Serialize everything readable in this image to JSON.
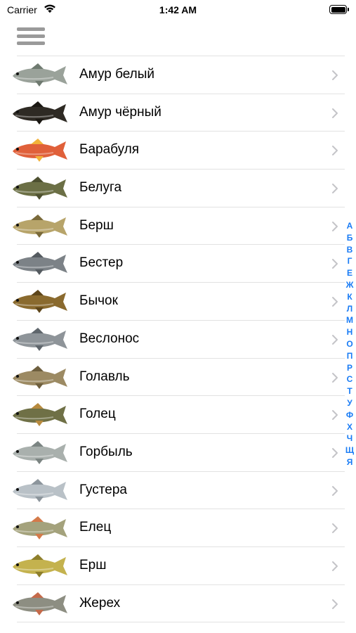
{
  "status_bar": {
    "carrier": "Carrier",
    "time": "1:42 AM",
    "icons": [
      "wifi-icon",
      "battery-icon"
    ]
  },
  "nav": {
    "menu_icon": "hamburger-menu-icon"
  },
  "colors": {
    "accent": "#1a7cf5",
    "separator": "#e2e2e2",
    "chevron": "#c4c4c8",
    "menu": "#9a9a9a"
  },
  "fish": [
    {
      "name": "Амур белый",
      "body": "#9aa29a",
      "fin": "#6f7a70"
    },
    {
      "name": "Амур чёрный",
      "body": "#2e2a24",
      "fin": "#1a1712"
    },
    {
      "name": "Барабуля",
      "body": "#e0603a",
      "fin": "#f2b23a"
    },
    {
      "name": "Белуга",
      "body": "#6b6f45",
      "fin": "#4d5030"
    },
    {
      "name": "Берш",
      "body": "#b7a46a",
      "fin": "#7a6a3a"
    },
    {
      "name": "Бестер",
      "body": "#7c8287",
      "fin": "#555b60"
    },
    {
      "name": "Бычок",
      "body": "#8a6a2e",
      "fin": "#5e461a"
    },
    {
      "name": "Веслонос",
      "body": "#8e9499",
      "fin": "#5f666c"
    },
    {
      "name": "Голавль",
      "body": "#9c8a63",
      "fin": "#6e5f3e"
    },
    {
      "name": "Голец",
      "body": "#6f7046",
      "fin": "#b78a3e"
    },
    {
      "name": "Горбыль",
      "body": "#a9b0ad",
      "fin": "#7b8482"
    },
    {
      "name": "Густера",
      "body": "#b9c1c7",
      "fin": "#8c959c"
    },
    {
      "name": "Елец",
      "body": "#a4a27c",
      "fin": "#d47a4a"
    },
    {
      "name": "Ерш",
      "body": "#c4b24e",
      "fin": "#8e7f2c"
    },
    {
      "name": "Жерех",
      "body": "#8d8e82",
      "fin": "#c56a4a"
    }
  ],
  "index_letters": [
    "А",
    "Б",
    "В",
    "Г",
    "Е",
    "Ж",
    "К",
    "Л",
    "М",
    "Н",
    "О",
    "П",
    "Р",
    "С",
    "Т",
    "У",
    "Ф",
    "Х",
    "Ч",
    "Щ",
    "Я"
  ]
}
